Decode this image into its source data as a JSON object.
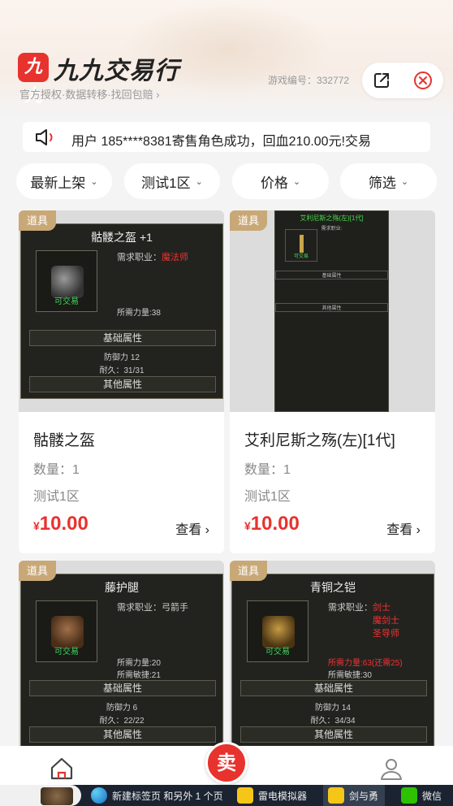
{
  "header": {
    "logo_mark": "九九",
    "brand": "九九交易行",
    "subtitle": "官方授权·数据转移·找回包赔 ›",
    "game_id_label": "游戏编号：",
    "game_id": "332772",
    "share_icon": "share-icon",
    "close_icon": "close-circle-icon"
  },
  "notice": {
    "icon": "speaker-icon",
    "text": "用户 185****8381寄售角色成功，回血210.00元!交易"
  },
  "filters": [
    {
      "label": "最新上架",
      "icon": "chevron-down-icon"
    },
    {
      "label": "测试1区",
      "icon": "chevron-down-icon"
    },
    {
      "label": "价格",
      "icon": "chevron-down-icon"
    },
    {
      "label": "筛选",
      "icon": "chevron-down-icon"
    }
  ],
  "chevron": "⌄",
  "items": [
    {
      "tag": "道具",
      "name": "骷髅之盔",
      "qty": "数量：1",
      "zone": "测试1区",
      "currency": "¥",
      "price": "10.00",
      "view": "查看 ›",
      "panel": {
        "title": "骷髅之盔 +1",
        "req_label": "需求职业：",
        "req_value": "魔法师",
        "tradable": "可交易",
        "str": "所需力量:38",
        "base_label": "基础属性",
        "def": "防御力 12",
        "dur": "耐久：31/31",
        "other_label": "其他属性"
      }
    },
    {
      "tag": "道具",
      "name": "艾利尼斯之殇(左)[1代]",
      "qty": "数量：1",
      "zone": "测试1区",
      "currency": "¥",
      "price": "10.00",
      "view": "查看 ›",
      "panel": {
        "title": "艾利尼斯之殇(左)[1代]",
        "req_label": "需求职业:",
        "tradable": "可交易",
        "base_label": "基础属性",
        "other_label": "其他属性"
      }
    },
    {
      "tag": "道具",
      "panel": {
        "title": "藤护腿",
        "req_label": "需求职业：",
        "req_value": "弓箭手",
        "tradable": "可交易",
        "str": "所需力量:20",
        "agi": "所需敏捷:21",
        "base_label": "基础属性",
        "def": "防御力 6",
        "dur": "耐久：22/22",
        "other_label": "其他属性"
      }
    },
    {
      "tag": "道具",
      "panel": {
        "title": "青铜之铠",
        "req_label": "需求职业：",
        "req_value": "剑士\n魔剑士\n圣导师",
        "tradable": "可交易",
        "str": "所需力量:63(还需25)",
        "agi": "所需敏捷:30",
        "base_label": "基础属性",
        "def": "防御力 14",
        "dur": "耐久：34/34",
        "other_label": "其他属性"
      }
    }
  ],
  "bottom_nav": {
    "home_icon": "home-icon",
    "sell_label": "卖",
    "user_icon": "user-icon"
  },
  "taskbar": [
    {
      "label": "",
      "icon": "game-thumbnail-icon"
    },
    {
      "label": "新建标签页 和另外 1 个页",
      "icon": "edge-browser-icon"
    },
    {
      "label": "雷电模拟器",
      "icon": "ldplayer-icon"
    },
    {
      "label": "剑与勇",
      "icon": "ldplayer-icon"
    },
    {
      "label": "微信",
      "icon": "wechat-icon"
    }
  ],
  "colors": {
    "accent": "#e8322d",
    "tag_gold": "#c9a877",
    "tradable_green": "#3fd85d"
  }
}
